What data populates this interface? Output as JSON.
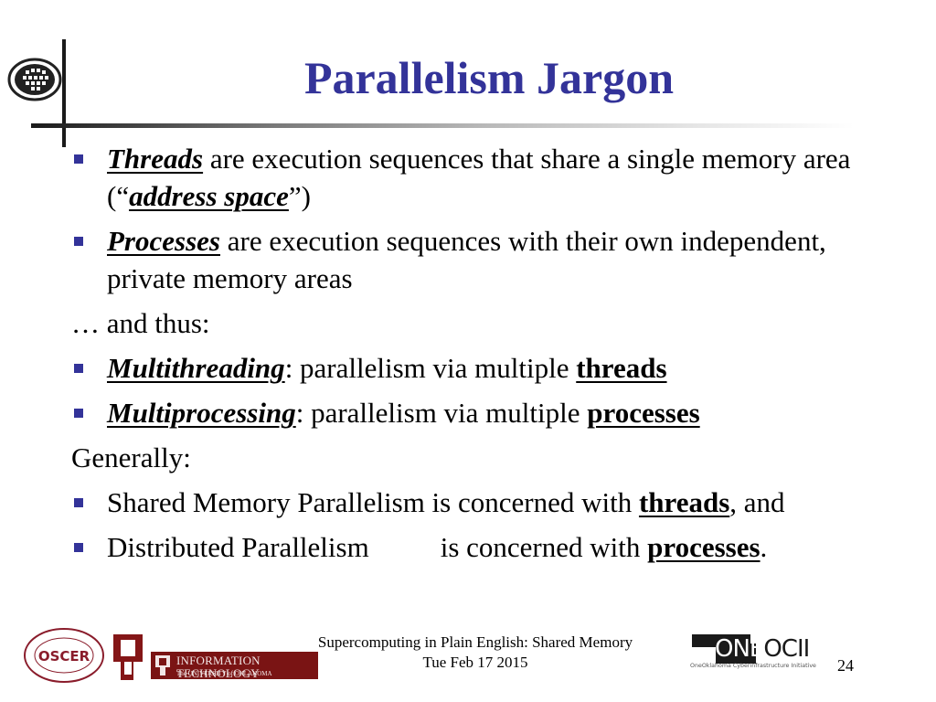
{
  "slide": {
    "title": "Parallelism Jargon",
    "accent_color": "#333399",
    "items": [
      {
        "type": "bullet",
        "parts": [
          {
            "text": "Threads",
            "style": "bold-italic-underline"
          },
          {
            "text": " are execution sequences that share a single memory area (“",
            "style": "normal"
          },
          {
            "text": "address space",
            "style": "bold-italic-underline"
          },
          {
            "text": "”)",
            "style": "normal"
          }
        ]
      },
      {
        "type": "bullet",
        "parts": [
          {
            "text": "Processes",
            "style": "bold-italic-underline"
          },
          {
            "text": " are execution sequences with their own independent, private memory areas",
            "style": "normal"
          }
        ]
      },
      {
        "type": "plain",
        "parts": [
          {
            "text": "… and thus:",
            "style": "normal"
          }
        ]
      },
      {
        "type": "bullet",
        "parts": [
          {
            "text": "Multithreading",
            "style": "bold-italic-underline"
          },
          {
            "text": ":  parallelism via multiple ",
            "style": "normal"
          },
          {
            "text": "threads",
            "style": "bold-underline"
          }
        ]
      },
      {
        "type": "bullet",
        "parts": [
          {
            "text": "Multiprocessing",
            "style": "bold-italic-underline"
          },
          {
            "text": ": parallelism via multiple ",
            "style": "normal"
          },
          {
            "text": "processes",
            "style": "bold-underline"
          }
        ]
      },
      {
        "type": "plain",
        "parts": [
          {
            "text": "Generally:",
            "style": "normal"
          }
        ]
      },
      {
        "type": "bullet",
        "parts": [
          {
            "text": "Shared Memory Parallelism is concerned with ",
            "style": "normal"
          },
          {
            "text": "threads",
            "style": "bold-underline"
          },
          {
            "text": ", and",
            "style": "normal"
          }
        ]
      },
      {
        "type": "bullet",
        "parts": [
          {
            "text": "Distributed Parallelism",
            "style": "normal"
          },
          {
            "text": "",
            "style": "tab"
          },
          {
            "text": "is concerned with ",
            "style": "normal"
          },
          {
            "text": "processes",
            "style": "bold-underline"
          },
          {
            "text": ".",
            "style": "normal"
          }
        ]
      }
    ]
  },
  "footer": {
    "line1": "Supercomputing in Plain English: Shared Memory",
    "line2": "Tue Feb 17 2015",
    "page_number": "24"
  },
  "logos": {
    "oscer_text": "OSCER",
    "it_text": "INFORMATION TECHNOLOGY",
    "it_subtext": "The UNIVERSITY of OKLAHOMA",
    "oneocii_one": "ONE",
    "oneocii_ocii": "OCII",
    "oneocii_tagline": "OneOklahoma Cyberinfrastructure Initiative",
    "ou_brand_color": "#841617"
  }
}
